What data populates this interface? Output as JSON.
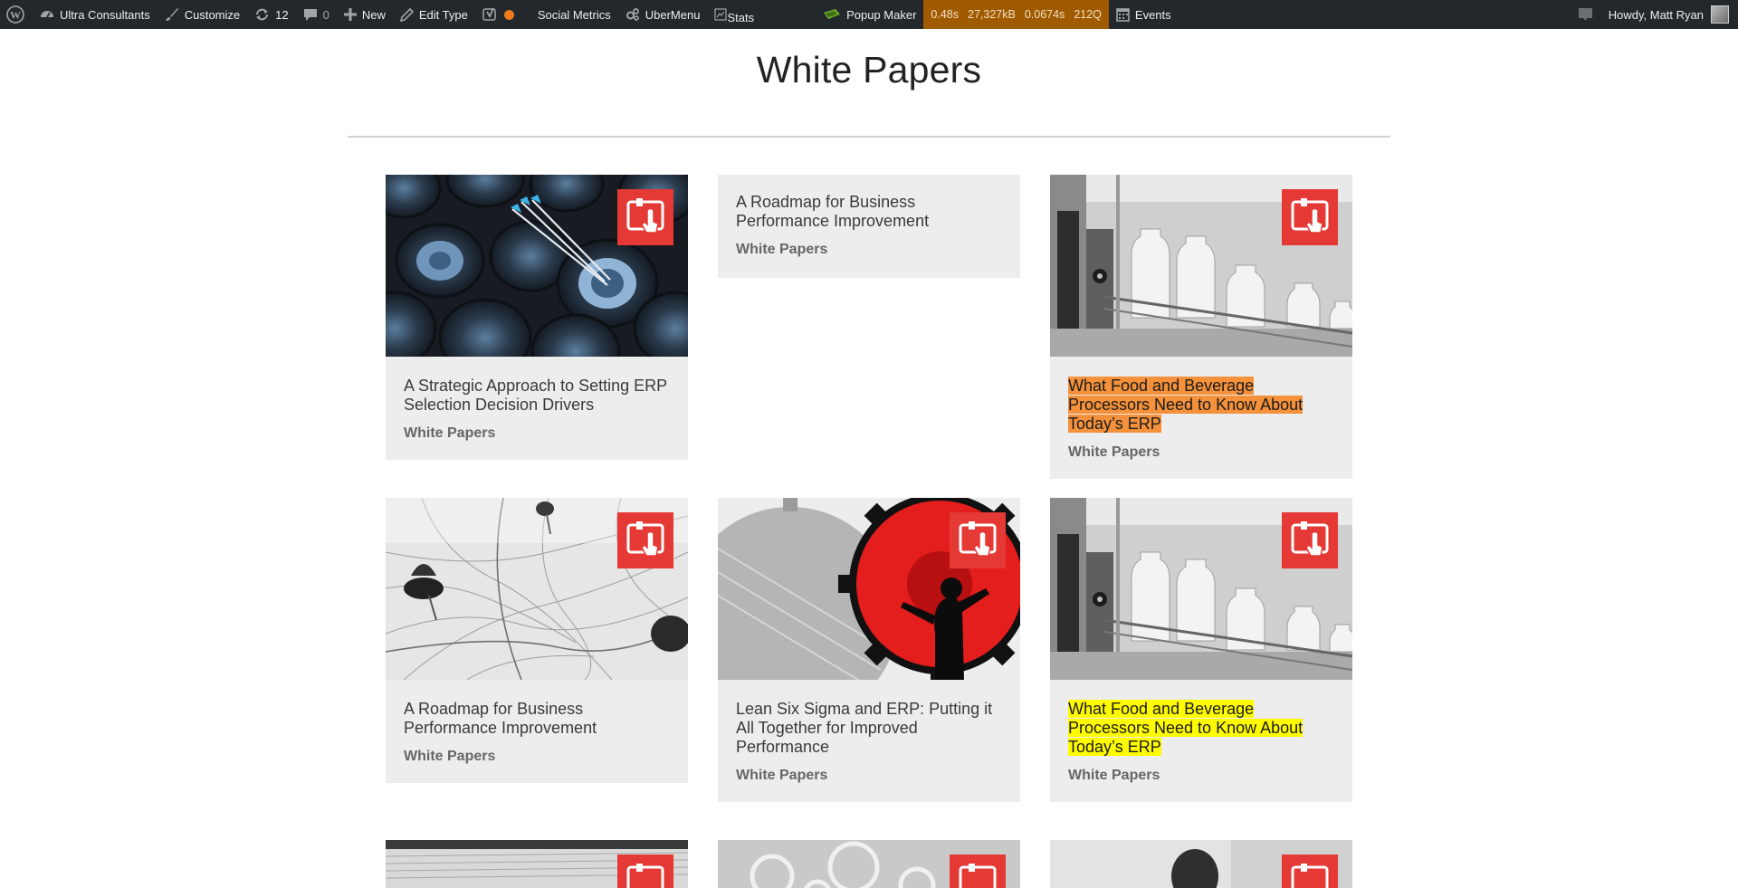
{
  "adminbar": {
    "site_name": "Ultra Consultants",
    "customize": "Customize",
    "updates_count": "12",
    "comments_count": "0",
    "new_label": "New",
    "edit_label": "Edit Type",
    "social_metrics": "Social Metrics",
    "ubermenu": "UberMenu",
    "stats_alt": "Stats",
    "popup_maker": "Popup Maker",
    "query_monitor": {
      "time": "0.48s",
      "memory": "27,327kB",
      "db_time": "0.0674s",
      "queries": "212Q"
    },
    "events": "Events",
    "howdy": "Howdy, Matt Ryan"
  },
  "page": {
    "title": "White Papers"
  },
  "cards": [
    {
      "title": "A Strategic Approach to Setting ERP Selection Decision Drivers",
      "category": "White Papers",
      "image": "targets-arrows"
    },
    {
      "title": "A Roadmap for Business Performance Improvement",
      "category": "White Papers",
      "image": ""
    },
    {
      "title": "What Food and Beverage Processors Need to Know About Today’s ERP",
      "category": "White Papers",
      "image": "bottling-line",
      "highlight": "#f4913a"
    },
    {
      "title": "A Roadmap for Business Performance Improvement",
      "category": "White Papers",
      "image": "map-pins"
    },
    {
      "title": "Lean Six Sigma and ERP: Putting it All Together for Improved Performance",
      "category": "White Papers",
      "image": "red-gear"
    },
    {
      "title": "What Food and Beverage Processors Need to Know About Today’s ERP",
      "category": "White Papers",
      "image": "bottling-line",
      "highlight": "#fffb00"
    }
  ],
  "colors": {
    "adminbar_bg": "#23282d",
    "query_monitor_bg": "#a05a00",
    "badge_red": "#e53935",
    "card_bg": "#ecedec"
  }
}
